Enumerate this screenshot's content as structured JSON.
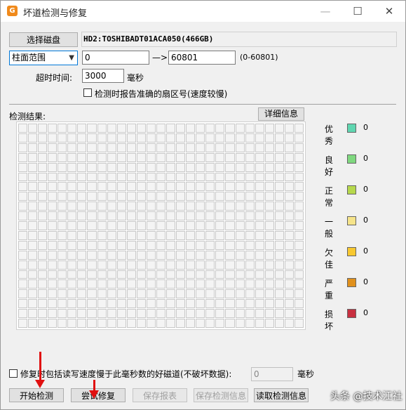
{
  "window": {
    "title": "坏道检测与修复",
    "app_icon_letter": "G",
    "minimize": "—",
    "maximize": "☐",
    "close": "✕"
  },
  "disk": {
    "select_button": "选择磁盘",
    "info": "HD2:TOSHIBADT01ACA050(466GB)"
  },
  "range": {
    "mode_selected": "柱面范围",
    "start": "0",
    "arrow": "—>",
    "end": "60801",
    "hint": "(0-60801)"
  },
  "timeout": {
    "label": "超时时间:",
    "value": "3000",
    "unit": "毫秒"
  },
  "report_sector_checkbox": {
    "label": "检测时报告准确的扇区号(速度较慢)",
    "checked": false
  },
  "results": {
    "label": "检测结果:",
    "details_button": "详细信息"
  },
  "legend": [
    {
      "name": "优秀",
      "color": "#5fd6b0",
      "count": "0"
    },
    {
      "name": "良好",
      "color": "#7fd87f",
      "count": "0"
    },
    {
      "name": "正常",
      "color": "#b6d84c",
      "count": "0"
    },
    {
      "name": "一般",
      "color": "#f6e48a",
      "count": "0"
    },
    {
      "name": "欠佳",
      "color": "#f8c830",
      "count": "0"
    },
    {
      "name": "严重",
      "color": "#e0901c",
      "count": "0"
    },
    {
      "name": "损坏",
      "color": "#c83040",
      "count": "0"
    }
  ],
  "repair_option": {
    "label": "修复时包括读写速度慢于此毫秒数的好磁道(不破坏数据):",
    "checked": false,
    "value": "0",
    "unit": "毫秒"
  },
  "buttons": {
    "start": "开始检测",
    "try_repair": "尝试修复",
    "save_report": "保存报表",
    "save_info": "保存检测信息",
    "load_info": "读取检测信息"
  },
  "watermark": "头条 @技术江社"
}
